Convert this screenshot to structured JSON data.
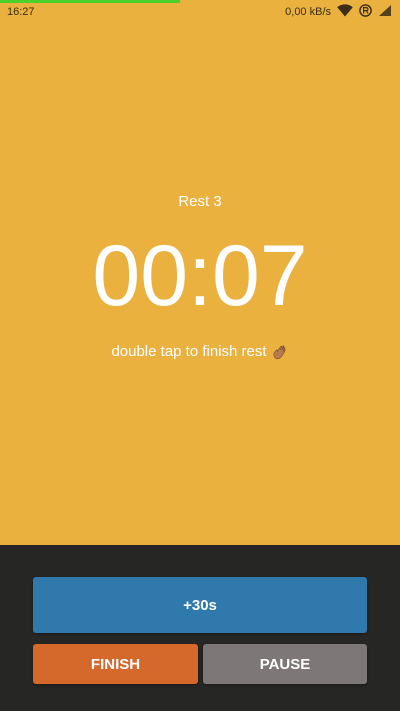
{
  "status_bar": {
    "time": "16:27",
    "network_speed": "0,00 kB/s",
    "icons": [
      "wifi-icon",
      "registered-icon",
      "signal-icon"
    ]
  },
  "progress": {
    "fraction": 0.45,
    "color": "#4cd12a"
  },
  "rest": {
    "label": "Rest 3",
    "timer": "00:07",
    "hint": "double tap to finish rest",
    "hint_icon": "waving-hand-icon"
  },
  "controls": {
    "add_time_label": "+30s",
    "finish_label": "FINISH",
    "pause_label": "PAUSE"
  },
  "colors": {
    "background": "#eab13f",
    "panel": "#262624",
    "add_time": "#2f79ad",
    "finish": "#d4692b",
    "pause": "#7d7777"
  }
}
